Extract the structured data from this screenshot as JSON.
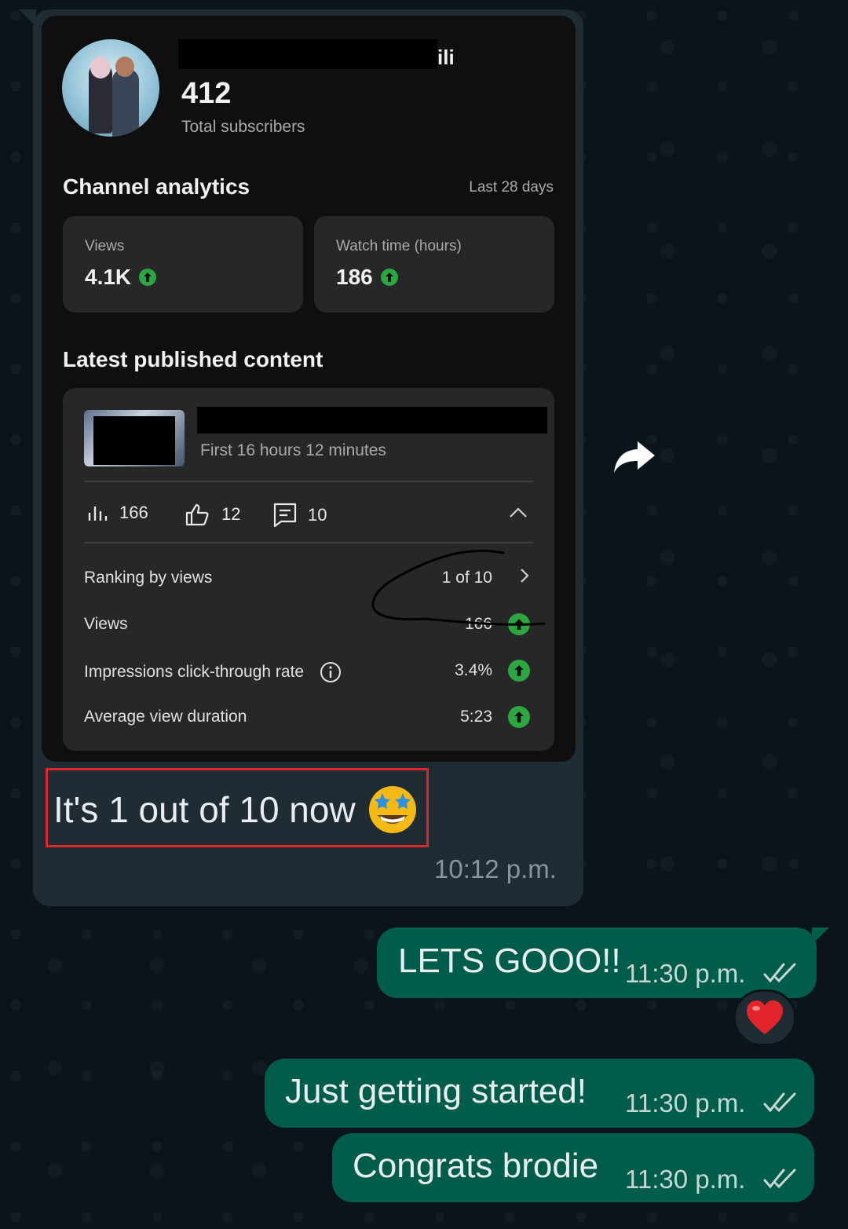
{
  "incoming": {
    "channel_name_visible_suffix": "ili",
    "subscriber_count": "412",
    "subscriber_label": "Total subscribers",
    "analytics_title": "Channel analytics",
    "analytics_period": "Last 28 days",
    "cards": [
      {
        "label": "Views",
        "value": "4.1K"
      },
      {
        "label": "Watch time (hours)",
        "value": "186"
      }
    ],
    "latest_title": "Latest published content",
    "video_timeframe": "First 16 hours 12 minutes",
    "stats": {
      "views": "166",
      "likes": "12",
      "comments": "10"
    },
    "rows": [
      {
        "label": "Ranking by views",
        "value": "1 of 10"
      },
      {
        "label": "Views",
        "value": "166"
      },
      {
        "label": "Impressions click-through rate",
        "value": "3.4%"
      },
      {
        "label": "Average view duration",
        "value": "5:23"
      }
    ],
    "message": "It's 1 out of 10 now",
    "time": "10:12 p.m."
  },
  "outgoing": [
    {
      "text": "LETS GOOO!!",
      "time": "11:30 p.m.",
      "reaction": "red-heart"
    },
    {
      "text": "Just getting started!",
      "time": "11:30 p.m."
    },
    {
      "text": "Congrats brodie",
      "time": "11:30 p.m."
    }
  ],
  "colors": {
    "incoming_bubble": "#202c33",
    "outgoing_bubble": "#005c4b",
    "positive": "#2ba640",
    "highlight": "#e0242b"
  }
}
